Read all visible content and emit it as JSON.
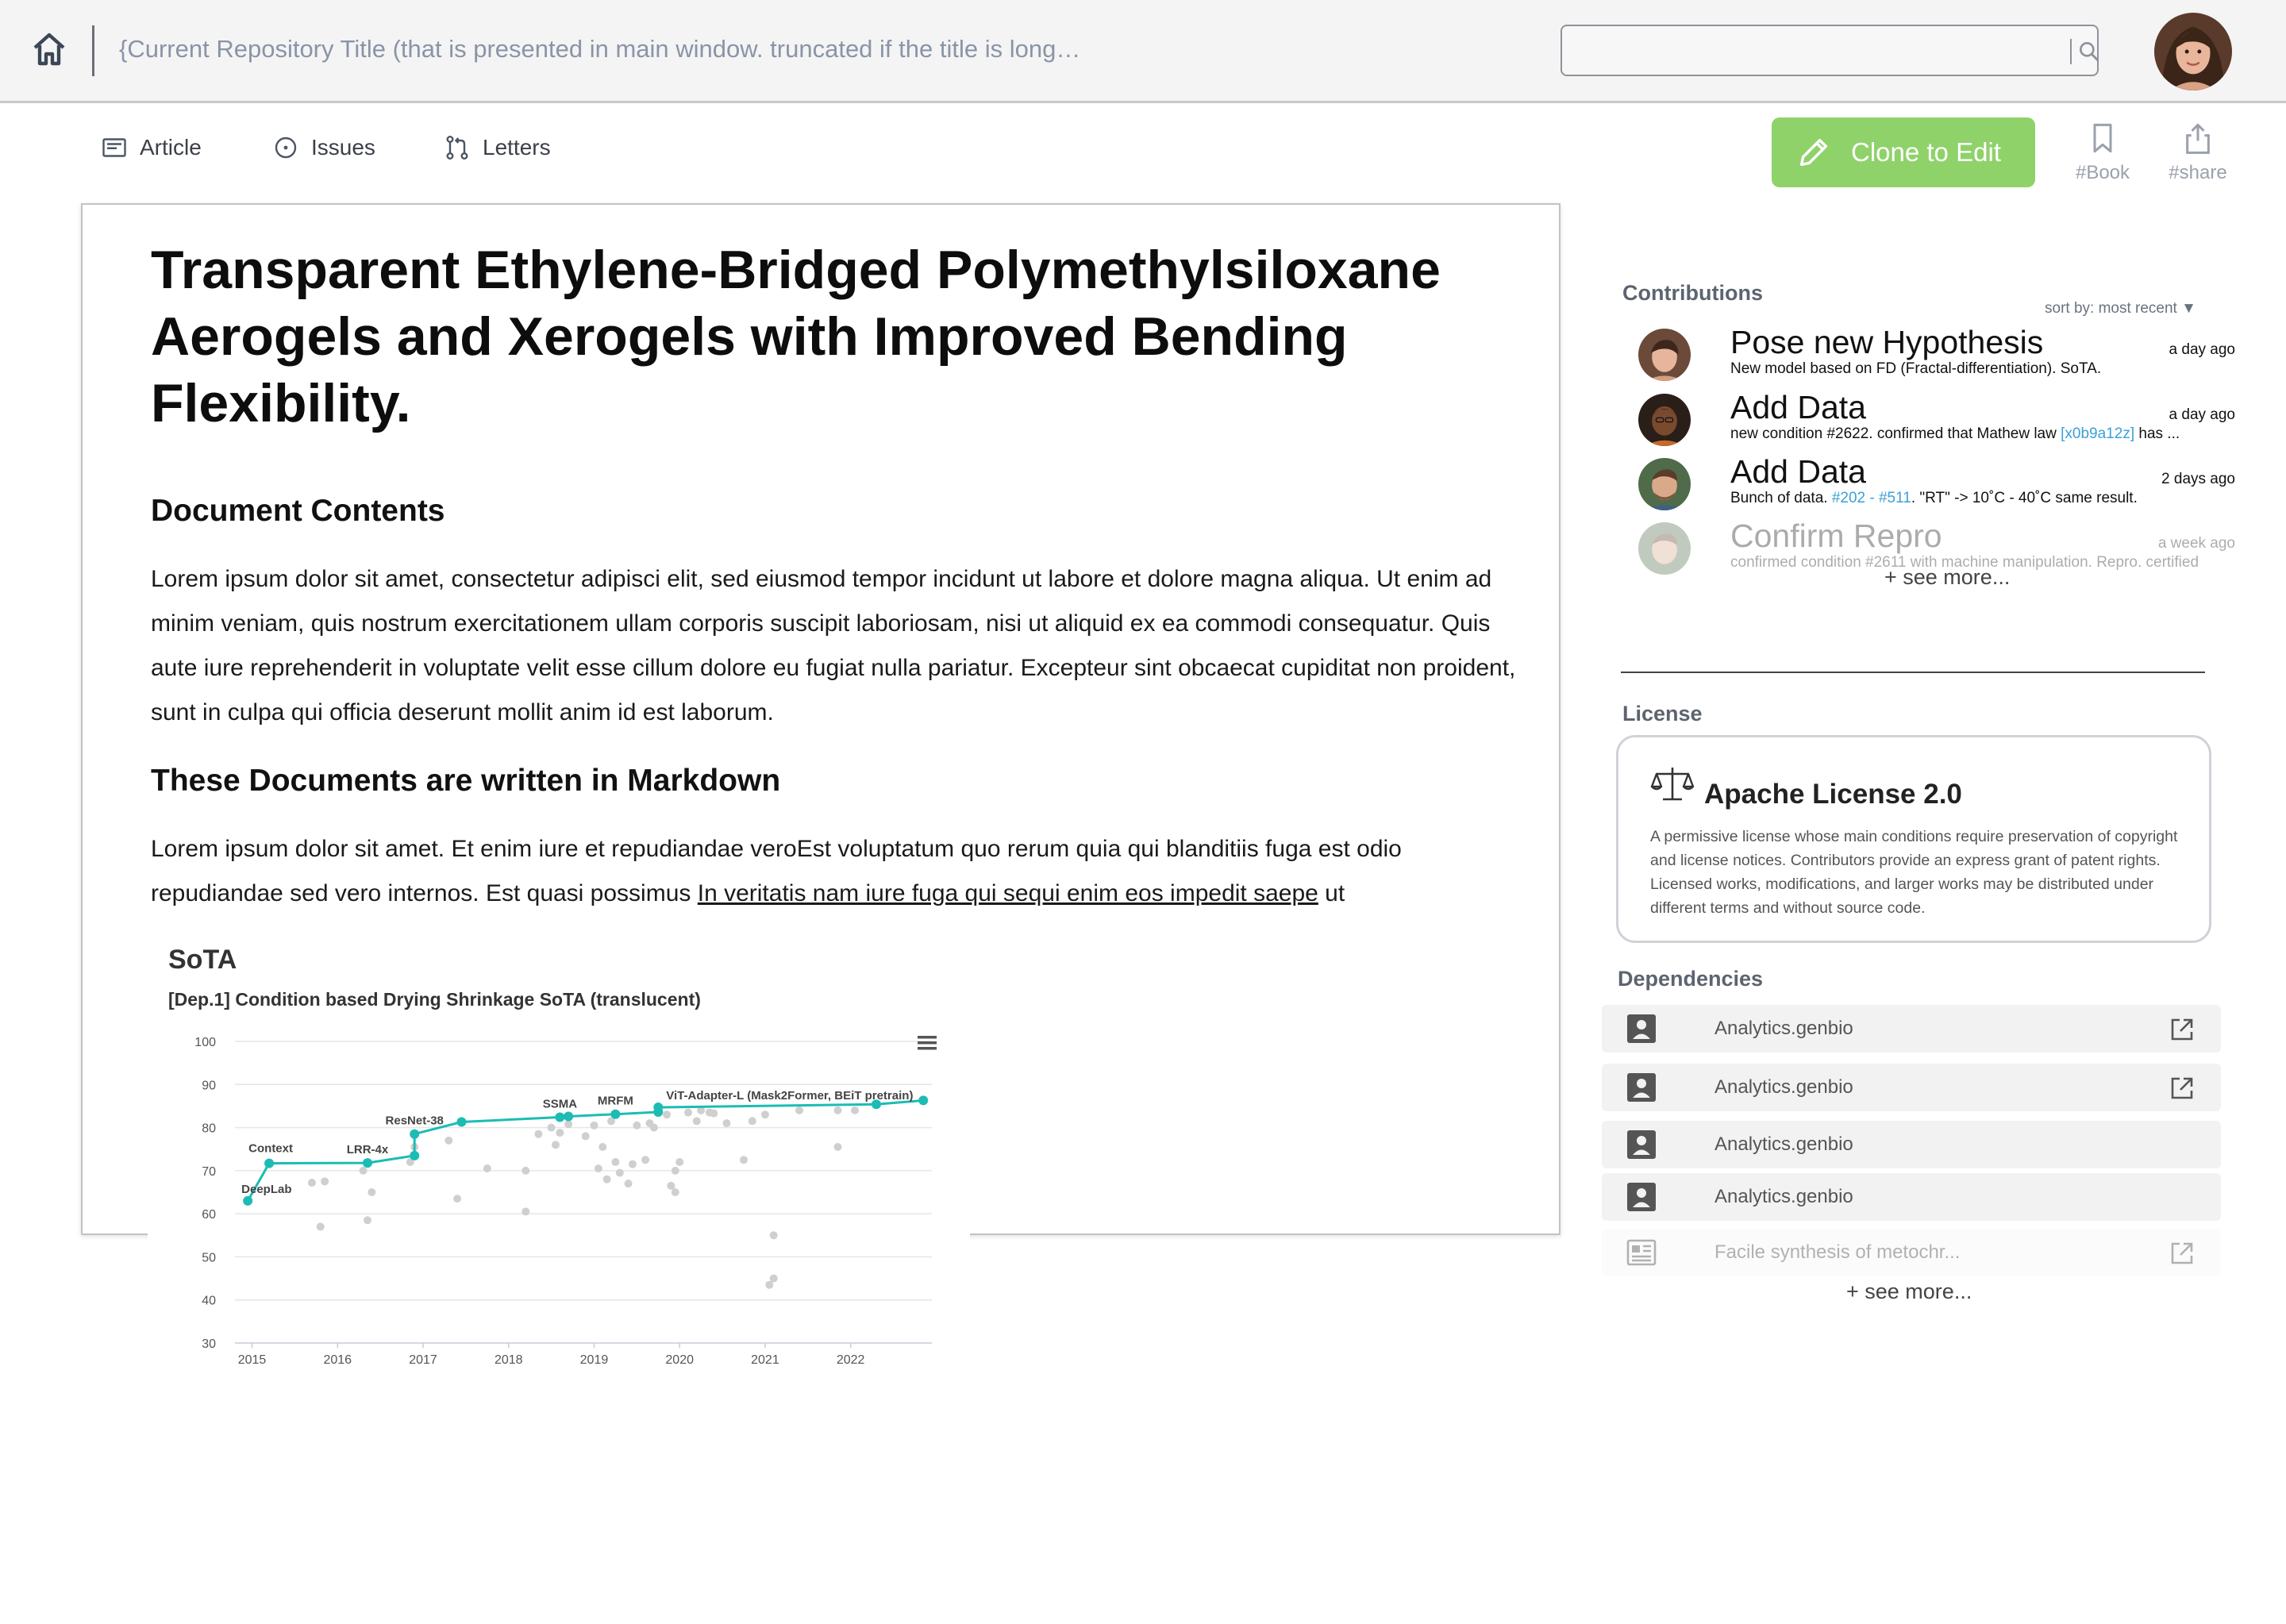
{
  "header": {
    "repo_title": "{Current Repository Title (that is presented in main window. truncated if the title is long…",
    "search_placeholder": ""
  },
  "tabs": [
    {
      "label": "Article"
    },
    {
      "label": "Issues"
    },
    {
      "label": "Letters"
    }
  ],
  "actions": {
    "clone_label": "Clone to Edit",
    "book_label": "#Book",
    "share_label": "#share"
  },
  "article": {
    "title": "Transparent Ethylene-Bridged Polymethylsiloxane Aerogels and Xerogels with Improved Bending Flexibility.",
    "section1_heading": "Document Contents",
    "section1_body": "Lorem ipsum dolor sit amet, consectetur adipisci elit, sed eiusmod tempor incidunt ut labore et dolore magna aliqua. Ut enim ad minim veniam, quis nostrum exercitationem ullam corporis suscipit laboriosam, nisi ut aliquid ex ea commodi consequatur. Quis aute iure reprehenderit in voluptate velit esse cillum dolore eu fugiat nulla pariatur. Excepteur sint obcaecat cupiditat non proident, sunt in culpa qui officia deserunt mollit anim id est laborum.",
    "section2_heading": "These Documents are written in Markdown",
    "section2_body_start": "Lorem ipsum dolor sit amet. Et enim iure et repudiandae veroEst voluptatum quo rerum quia qui blanditiis fuga est odio repudiandae sed vero internos. Est quasi possimus ",
    "section2_link": "In veritatis nam iure fuga qui sequi enim eos impedit saepe",
    "section2_body_end": " ut"
  },
  "chart": {
    "title": "SoTA",
    "subtitle": "[Dep.1] Condition based Drying Shrinkage SoTA (translucent)"
  },
  "chart_data": {
    "type": "scatter",
    "title": "SoTA",
    "subtitle": "[Dep.1] Condition based Drying Shrinkage SoTA (translucent)",
    "xlabel": "",
    "ylabel": "",
    "xlim": [
      2014.8,
      2022.95
    ],
    "ylim": [
      30,
      100
    ],
    "x_ticks": [
      "2015",
      "2016",
      "2017",
      "2018",
      "2019",
      "2020",
      "2021",
      "2022"
    ],
    "y_ticks": [
      "30",
      "40",
      "50",
      "60",
      "70",
      "80",
      "90",
      "100"
    ],
    "grid": true,
    "series": [
      {
        "role": "sota-line",
        "color": "#1cbcb4",
        "points": [
          [
            2014.95,
            63.0
          ],
          [
            2015.2,
            71.7
          ],
          [
            2016.35,
            71.8
          ],
          [
            2016.9,
            73.5
          ],
          [
            2016.9,
            78.5
          ],
          [
            2017.45,
            81.3
          ],
          [
            2018.6,
            82.4
          ],
          [
            2018.7,
            82.6
          ],
          [
            2019.25,
            83.1
          ],
          [
            2019.75,
            83.6
          ],
          [
            2019.75,
            84.7
          ],
          [
            2022.3,
            85.4
          ],
          [
            2022.85,
            86.3
          ]
        ]
      },
      {
        "role": "other-methods",
        "color": "#cfcfcf",
        "points": [
          [
            2015.7,
            67.2
          ],
          [
            2015.85,
            67.5
          ],
          [
            2015.8,
            57.0
          ],
          [
            2016.3,
            70.0
          ],
          [
            2016.35,
            58.5
          ],
          [
            2016.4,
            65.0
          ],
          [
            2016.85,
            72.0
          ],
          [
            2016.9,
            75.5
          ],
          [
            2017.4,
            63.5
          ],
          [
            2017.3,
            77.0
          ],
          [
            2017.75,
            70.5
          ],
          [
            2018.2,
            70.0
          ],
          [
            2018.35,
            78.5
          ],
          [
            2018.5,
            80.0
          ],
          [
            2018.55,
            76.0
          ],
          [
            2018.6,
            78.8
          ],
          [
            2018.7,
            80.8
          ],
          [
            2018.9,
            78.0
          ],
          [
            2019.0,
            80.5
          ],
          [
            2019.1,
            75.5
          ],
          [
            2019.2,
            81.5
          ],
          [
            2019.05,
            70.5
          ],
          [
            2019.15,
            68.0
          ],
          [
            2019.25,
            72.0
          ],
          [
            2019.3,
            69.5
          ],
          [
            2019.4,
            67.0
          ],
          [
            2019.45,
            71.5
          ],
          [
            2019.5,
            80.5
          ],
          [
            2019.6,
            72.5
          ],
          [
            2019.65,
            81.0
          ],
          [
            2019.7,
            80.0
          ],
          [
            2019.85,
            83.0
          ],
          [
            2019.9,
            66.5
          ],
          [
            2019.95,
            70.0
          ],
          [
            2019.95,
            65.0
          ],
          [
            2020.0,
            72.0
          ],
          [
            2020.1,
            83.5
          ],
          [
            2020.2,
            81.5
          ],
          [
            2020.25,
            84.0
          ],
          [
            2020.35,
            83.5
          ],
          [
            2020.4,
            83.3
          ],
          [
            2020.55,
            81.0
          ],
          [
            2020.75,
            72.5
          ],
          [
            2020.85,
            81.5
          ],
          [
            2021.0,
            83.0
          ],
          [
            2021.1,
            55.0
          ],
          [
            2021.1,
            45.0
          ],
          [
            2021.05,
            43.5
          ],
          [
            2021.4,
            84.0
          ],
          [
            2021.85,
            75.5
          ],
          [
            2021.85,
            84.0
          ],
          [
            2022.05,
            84.0
          ],
          [
            2018.2,
            60.5
          ]
        ]
      }
    ],
    "annotations": [
      {
        "text": "DeepLab",
        "x": 2014.95,
        "y": 63.0
      },
      {
        "text": "Context",
        "x": 2015.2,
        "y": 71.7
      },
      {
        "text": "LRR-4x",
        "x": 2016.35,
        "y": 71.8
      },
      {
        "text": "ResNet-38",
        "x": 2016.9,
        "y": 78.5
      },
      {
        "text": "SSMA",
        "x": 2018.6,
        "y": 82.4
      },
      {
        "text": "MRFM",
        "x": 2019.25,
        "y": 83.1
      },
      {
        "text": "ViT-Adapter-L (Mask2Former, BEiT pretrain)",
        "x": 2019.75,
        "y": 84.7
      }
    ]
  },
  "contributions": {
    "label": "Contributions",
    "sort_label": "sort by: most recent",
    "items": [
      {
        "title": "Pose new Hypothesis",
        "time": "a day ago",
        "desc_pre": "New model based on FD (Fractal-differentiation). SoTA.",
        "desc_link": "",
        "desc_post": ""
      },
      {
        "title": "Add Data",
        "time": "a day ago",
        "desc_pre": "new condition #2622. confirmed that Mathew law ",
        "desc_link": "[x0b9a12z]",
        "desc_post": " has ..."
      },
      {
        "title": "Add Data",
        "time": "2 days ago",
        "desc_pre": "Bunch of data. ",
        "desc_link": "#202 - #511",
        "desc_post": ". \"RT\" -> 10˚C -  40˚C same result."
      },
      {
        "title": "Confirm Repro",
        "time": "a week ago",
        "desc_pre": "confirmed condition #2611 with machine manipulation. Repro. certified",
        "desc_link": "",
        "desc_post": ""
      }
    ],
    "see_more": "+ see more..."
  },
  "license": {
    "label": "License",
    "name": "Apache License 2.0",
    "description": "A permissive license whose main conditions require preservation of copyright and license notices. Contributors provide an express grant of patent rights. Licensed works, modifications, and larger works may be distributed under different terms and without source code."
  },
  "dependencies": {
    "label": "Dependencies",
    "items": [
      {
        "name": "Analytics.genbio"
      },
      {
        "name": "Analytics.genbio"
      },
      {
        "name": "Analytics.genbio"
      },
      {
        "name": "Analytics.genbio"
      },
      {
        "name": "Facile synthesis of metochr..."
      }
    ],
    "see_more": "+ see more..."
  },
  "colors": {
    "accent_green": "#8fd26a",
    "sota_line": "#1cbcb4",
    "link_blue": "#3aa0d8"
  }
}
